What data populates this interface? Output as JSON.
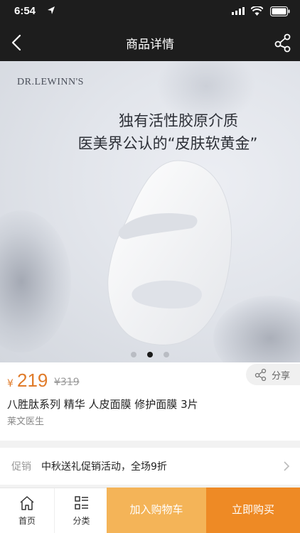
{
  "status": {
    "time": "6:54"
  },
  "nav": {
    "title": "商品详情"
  },
  "banner": {
    "brand": "DR.LEWINN'S",
    "tagline1": "独有活性胶原介质",
    "tagline2": "医美界公认的“皮肤软黄金”",
    "dots": 3,
    "active_dot": 1
  },
  "product": {
    "currency": "¥",
    "price": "219",
    "original_price": "¥319",
    "share_label": "分享",
    "name": "八胜肽系列 精华 人皮面膜 修护面膜 3片",
    "brand": "莱文医生"
  },
  "promo": {
    "label": "促销",
    "text": "中秋送礼促销活动，全场9折"
  },
  "tabbar": {
    "home": "首页",
    "category": "分类"
  },
  "actions": {
    "add_to_cart": "加入购物车",
    "buy_now": "立即购买"
  },
  "colors": {
    "accent": "#ee8a25",
    "cart": "#f4b458",
    "dark_header": "#1d1d1d",
    "price": "#e07b2a"
  },
  "icons": [
    "location-arrow-icon",
    "signal-icon",
    "wifi-icon",
    "battery-icon",
    "back-arrow-icon",
    "share-icon",
    "chevron-right-icon",
    "home-icon",
    "category-list-icon"
  ]
}
